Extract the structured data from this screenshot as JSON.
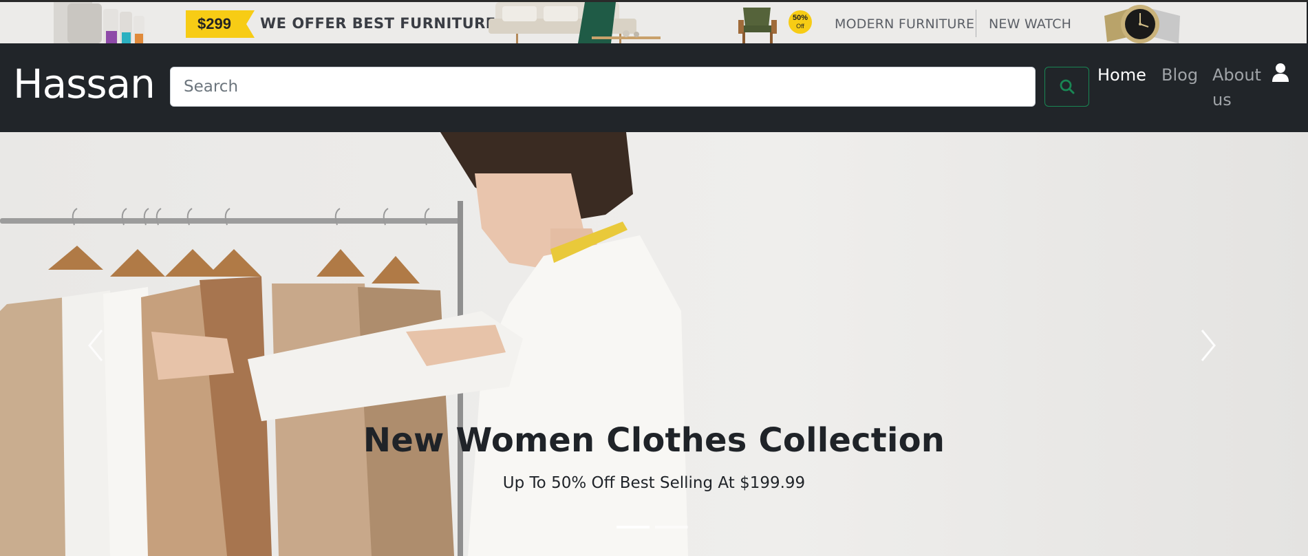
{
  "promo": {
    "price": "$299",
    "headline": "WE OFFER BEST FURNITURE",
    "badge_percent": "50%",
    "badge_off": "Off",
    "links": [
      "MODERN FURNITURE",
      "NEW WATCH"
    ]
  },
  "navbar": {
    "brand": "Hassan",
    "search_placeholder": "Search",
    "search_value": "",
    "nav_items": [
      "Home",
      "Blog",
      "About us"
    ],
    "active_item": "Home"
  },
  "hero": {
    "title": "New Women Clothes Collection",
    "subtitle": "Up To 50% Off Best Selling At $199.99",
    "slide_count": 2,
    "active_slide": 1
  },
  "icons": {
    "search": "search-icon",
    "user": "user-icon",
    "prev": "chevron-left-icon",
    "next": "chevron-right-icon"
  },
  "colors": {
    "navbar_bg": "#212529",
    "promo_bg": "#ecebe9",
    "price_tag": "#f7cc15",
    "search_accent": "#198754"
  }
}
